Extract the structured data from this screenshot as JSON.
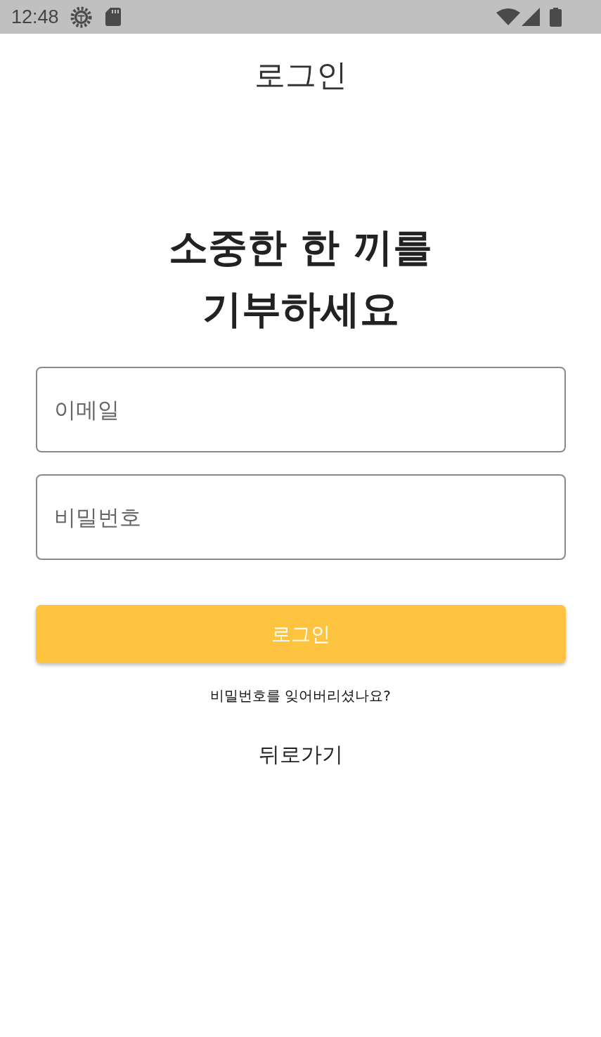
{
  "status_bar": {
    "time": "12:48"
  },
  "header": {
    "title": "로그인"
  },
  "headline": {
    "lines": [
      "소중한 한 끼를",
      "기부하세요"
    ]
  },
  "fields": [
    {
      "placeholder": "이메일"
    },
    {
      "placeholder": "비밀번호"
    }
  ],
  "login_button": {
    "label": "로그인"
  },
  "forgot_link": {
    "label": "비밀번호를 잊어버리셨나요?"
  },
  "back_button": {
    "label": "뒤로가기"
  }
}
